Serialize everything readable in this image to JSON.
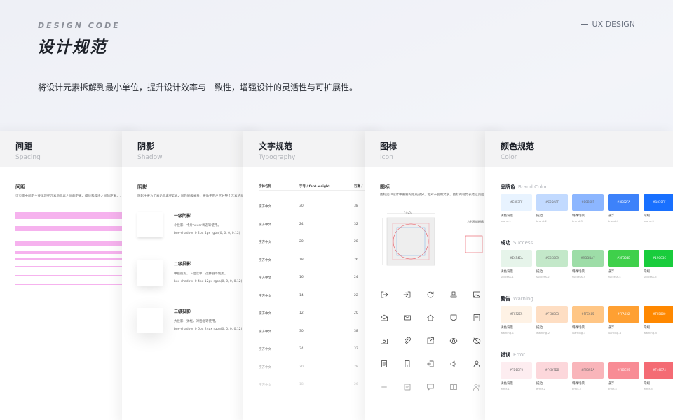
{
  "header": {
    "eyebrow": "DESIGN CODE",
    "title": "设计规范",
    "tag": "UX DESIGN",
    "subtitle": "将设计元素拆解到最小单位，提升设计效率与一致性，增强设计的灵活性与可扩展性。"
  },
  "cards": [
    {
      "title": "间距",
      "en": "Spacing"
    },
    {
      "title": "阴影",
      "en": "Shadow"
    },
    {
      "title": "文字规范",
      "en": "Typography"
    },
    {
      "title": "图标",
      "en": "Icon"
    },
    {
      "title": "颜色规范",
      "en": "Color"
    }
  ],
  "spacing": {
    "section": "间距",
    "desc": "页页面中间距主要体现在元素与元素之间的距离、模块和模块之间的距离，…"
  },
  "shadow": {
    "section": "阴影",
    "desc": "阴影主要为了表达元素在Z轴之间的层级关系，将做于用户区分整个元素的状…",
    "levels": [
      {
        "name": "一级阴影",
        "use": "小投影，卡片hover状态等使用。",
        "css": "box-shadow: 0 2px 4px rgba(0, 0, 0, 0.12)"
      },
      {
        "name": "二级投影",
        "use": "中投投影，下拉菜单、选择器等使用。",
        "css": "box-shadow: 0 4px 12px rgba(0, 0, 0, 0.12)"
      },
      {
        "name": "三级投影",
        "use": "大投影，弹框，对话框等使用。",
        "css": "box-shadow: 0 6px 24px rgba(0, 0, 0, 0.12)"
      }
    ]
  },
  "typography": {
    "headers": [
      "字体名称",
      "字号 / font-weight",
      "行高 /"
    ],
    "rows": [
      [
        "字方中文",
        "30",
        "38"
      ],
      [
        "字方中文",
        "24",
        "32"
      ],
      [
        "字方中文",
        "20",
        "28"
      ],
      [
        "字方中文",
        "18",
        "26"
      ],
      [
        "字方中文",
        "16",
        "24"
      ],
      [
        "字方中文",
        "14",
        "22"
      ],
      [
        "字方中文",
        "12",
        "20"
      ],
      [
        "字方中文",
        "30",
        "38"
      ],
      [
        "字方中文",
        "24",
        "32"
      ],
      [
        "字方中文",
        "20",
        "28"
      ],
      [
        "字方中文",
        "18",
        "26"
      ]
    ]
  },
  "icon": {
    "section": "图标",
    "desc": "图标是UI设计中重要的组成部分，相对于使用文字，图标的视觉表达让页面…",
    "dim_label": "24x24",
    "keyline_label": "方形图标栅格",
    "icons": [
      "login-icon",
      "enter-icon",
      "refresh-icon",
      "stamp-icon",
      "image-icon",
      "mail-open-icon",
      "mail-icon",
      "home-icon",
      "map-icon",
      "card-icon",
      "camera-icon",
      "paperclip-icon",
      "share-icon",
      "eye-icon",
      "eye-off-icon",
      "doc-icon",
      "phone-icon",
      "exit-icon",
      "volume-icon",
      "user-icon",
      "minus-icon",
      "message-icon",
      "chat-icon",
      "book-icon",
      "user-add-icon"
    ]
  },
  "colors": {
    "groups": [
      {
        "title": "品牌色",
        "en": "Brand Color",
        "swatches": [
          {
            "hex": "#E8F3FF",
            "label": "浅色背景",
            "key": "brand-1"
          },
          {
            "hex": "#C2DAFF",
            "label": "描边",
            "key": "brand-2"
          },
          {
            "hex": "#8CB6FF",
            "label": "特殊场景",
            "key": "brand-3"
          },
          {
            "hex": "#3D82FA",
            "label": "悬浮",
            "key": "brand-4"
          },
          {
            "hex": "#1870FF",
            "label": "常规",
            "key": "brand-5"
          }
        ]
      },
      {
        "title": "成功",
        "en": "Success",
        "swatches": [
          {
            "hex": "#E6F4EA",
            "label": "浅色背景",
            "key": "success-1"
          },
          {
            "hex": "#C3E8C9",
            "label": "描边",
            "key": "success-2"
          },
          {
            "hex": "#9DDDA7",
            "label": "特殊场景",
            "key": "success-3"
          },
          {
            "hex": "#3FD04B",
            "label": "悬浮",
            "key": "success-4"
          },
          {
            "hex": "#19CC3C",
            "label": "常规",
            "key": "success-5"
          }
        ]
      },
      {
        "title": "警告",
        "en": "Warning",
        "swatches": [
          {
            "hex": "#FEF2E5",
            "label": "浅色背景",
            "key": "warning-1"
          },
          {
            "hex": "#FEDEC3",
            "label": "描边",
            "key": "warning-2"
          },
          {
            "hex": "#FFC685",
            "label": "特殊场景",
            "key": "warning-3"
          },
          {
            "hex": "#FFA032",
            "label": "悬浮",
            "key": "warning-4"
          },
          {
            "hex": "#FF8800",
            "label": "常规",
            "key": "warning-5"
          }
        ]
      },
      {
        "title": "错误",
        "en": "Error",
        "swatches": [
          {
            "hex": "#FDEDF0",
            "label": "浅色背景",
            "key": "error-1"
          },
          {
            "hex": "#FCD7DB",
            "label": "描边",
            "key": "error-2"
          },
          {
            "hex": "#F9B5BA",
            "label": "特殊场景",
            "key": "error-3"
          },
          {
            "hex": "#F88C95",
            "label": "悬浮",
            "key": "error-4"
          },
          {
            "hex": "#F46B74",
            "label": "常规",
            "key": "error-5"
          }
        ]
      }
    ]
  },
  "accent": {
    "spacing_bar": "#F6B2EE",
    "keyline": "#E8515B"
  }
}
